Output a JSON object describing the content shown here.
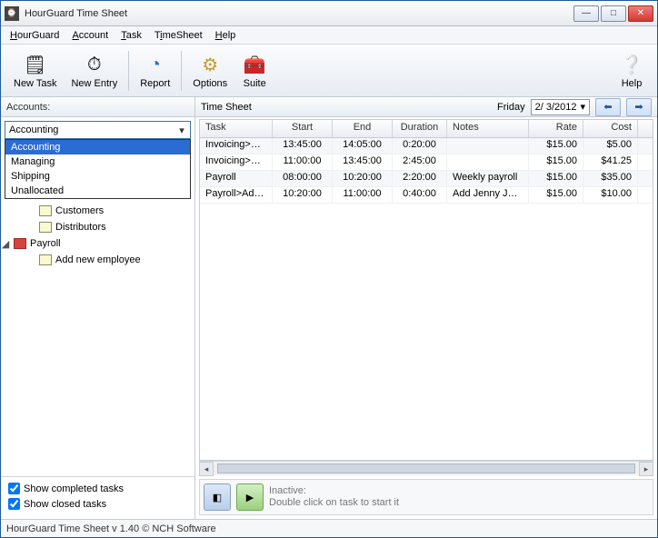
{
  "window": {
    "title": "HourGuard Time Sheet"
  },
  "menu": {
    "hourguard": "HourGuard",
    "account": "Account",
    "task": "Task",
    "timesheet": "TimeSheet",
    "help": "Help"
  },
  "toolbar": {
    "new_task": "New Task",
    "new_entry": "New Entry",
    "report": "Report",
    "options": "Options",
    "suite": "Suite",
    "help": "Help"
  },
  "accounts": {
    "label": "Accounts:",
    "selected": "Accounting",
    "options": [
      "Accounting",
      "Managing",
      "Shipping",
      "Unallocated"
    ],
    "tree": {
      "customers": "Customers",
      "distributors": "Distributors",
      "payroll": "Payroll",
      "add_new_employee": "Add new employee"
    },
    "show_completed": "Show completed tasks",
    "show_closed": "Show closed tasks"
  },
  "timesheet": {
    "label": "Time Sheet",
    "day": "Friday",
    "date": "2/ 3/2012",
    "columns": {
      "task": "Task",
      "start": "Start",
      "end": "End",
      "duration": "Duration",
      "notes": "Notes",
      "rate": "Rate",
      "cost": "Cost"
    },
    "rows": [
      {
        "task": "Invoicing>Cu...",
        "start": "13:45:00",
        "end": "14:05:00",
        "duration": "0:20:00",
        "notes": "",
        "rate": "$15.00",
        "cost": "$5.00"
      },
      {
        "task": "Invoicing>Dis...",
        "start": "11:00:00",
        "end": "13:45:00",
        "duration": "2:45:00",
        "notes": "",
        "rate": "$15.00",
        "cost": "$41.25"
      },
      {
        "task": "Payroll",
        "start": "08:00:00",
        "end": "10:20:00",
        "duration": "2:20:00",
        "notes": "Weekly payroll",
        "rate": "$15.00",
        "cost": "$35.00"
      },
      {
        "task": "Payroll>Add ...",
        "start": "10:20:00",
        "end": "11:00:00",
        "duration": "0:40:00",
        "notes": "Add Jenny Jones",
        "rate": "$15.00",
        "cost": "$10.00"
      }
    ]
  },
  "status": {
    "line1": "Inactive:",
    "line2": "Double click on task to start it"
  },
  "footer": {
    "text": "HourGuard Time Sheet v 1.40 © NCH Software"
  }
}
